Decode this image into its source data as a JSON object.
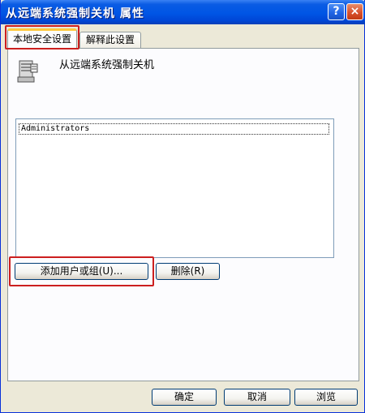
{
  "window": {
    "title": "从远端系统强制关机 属性",
    "help_label": "?",
    "close_label": "×"
  },
  "tabs": [
    {
      "label": "本地安全设置",
      "active": true
    },
    {
      "label": "解释此设置",
      "active": false
    }
  ],
  "policy": {
    "icon": "policy-server-icon",
    "name": "从远端系统强制关机"
  },
  "user_list": {
    "items": [
      "Administrators"
    ]
  },
  "buttons": {
    "add": "添加用户或组(U)...",
    "remove": "删除(R)",
    "ok": "确定",
    "cancel": "取消",
    "browse": "浏览"
  },
  "colors": {
    "titlebar": "#0055e5",
    "dialog_face": "#ece9d8",
    "highlight": "#cc1f1f",
    "active_tab_accent": "#ffc83c"
  }
}
